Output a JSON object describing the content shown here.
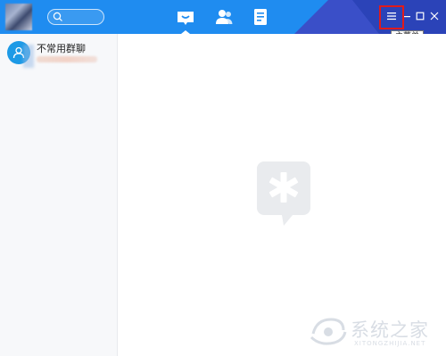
{
  "titlebar": {
    "tabs": [
      {
        "icon": "chat-bubble-icon",
        "active": true
      },
      {
        "icon": "contacts-icon",
        "active": false
      },
      {
        "icon": "document-icon",
        "active": false
      }
    ],
    "menu_icon": "menu-icon",
    "tooltip": "主菜单",
    "colors": {
      "primary": "#1f8cf0",
      "dark": "#2b43b8",
      "highlight": "#e11b1b"
    }
  },
  "sidebar": {
    "conversations": [
      {
        "title": "不常用群聊",
        "icon": "group-icon"
      }
    ]
  },
  "main": {
    "placeholder_icon": "dingtalk-logo-icon"
  },
  "watermark": {
    "text": "系统之家",
    "url": "XITONGZHIJIA.NET"
  }
}
